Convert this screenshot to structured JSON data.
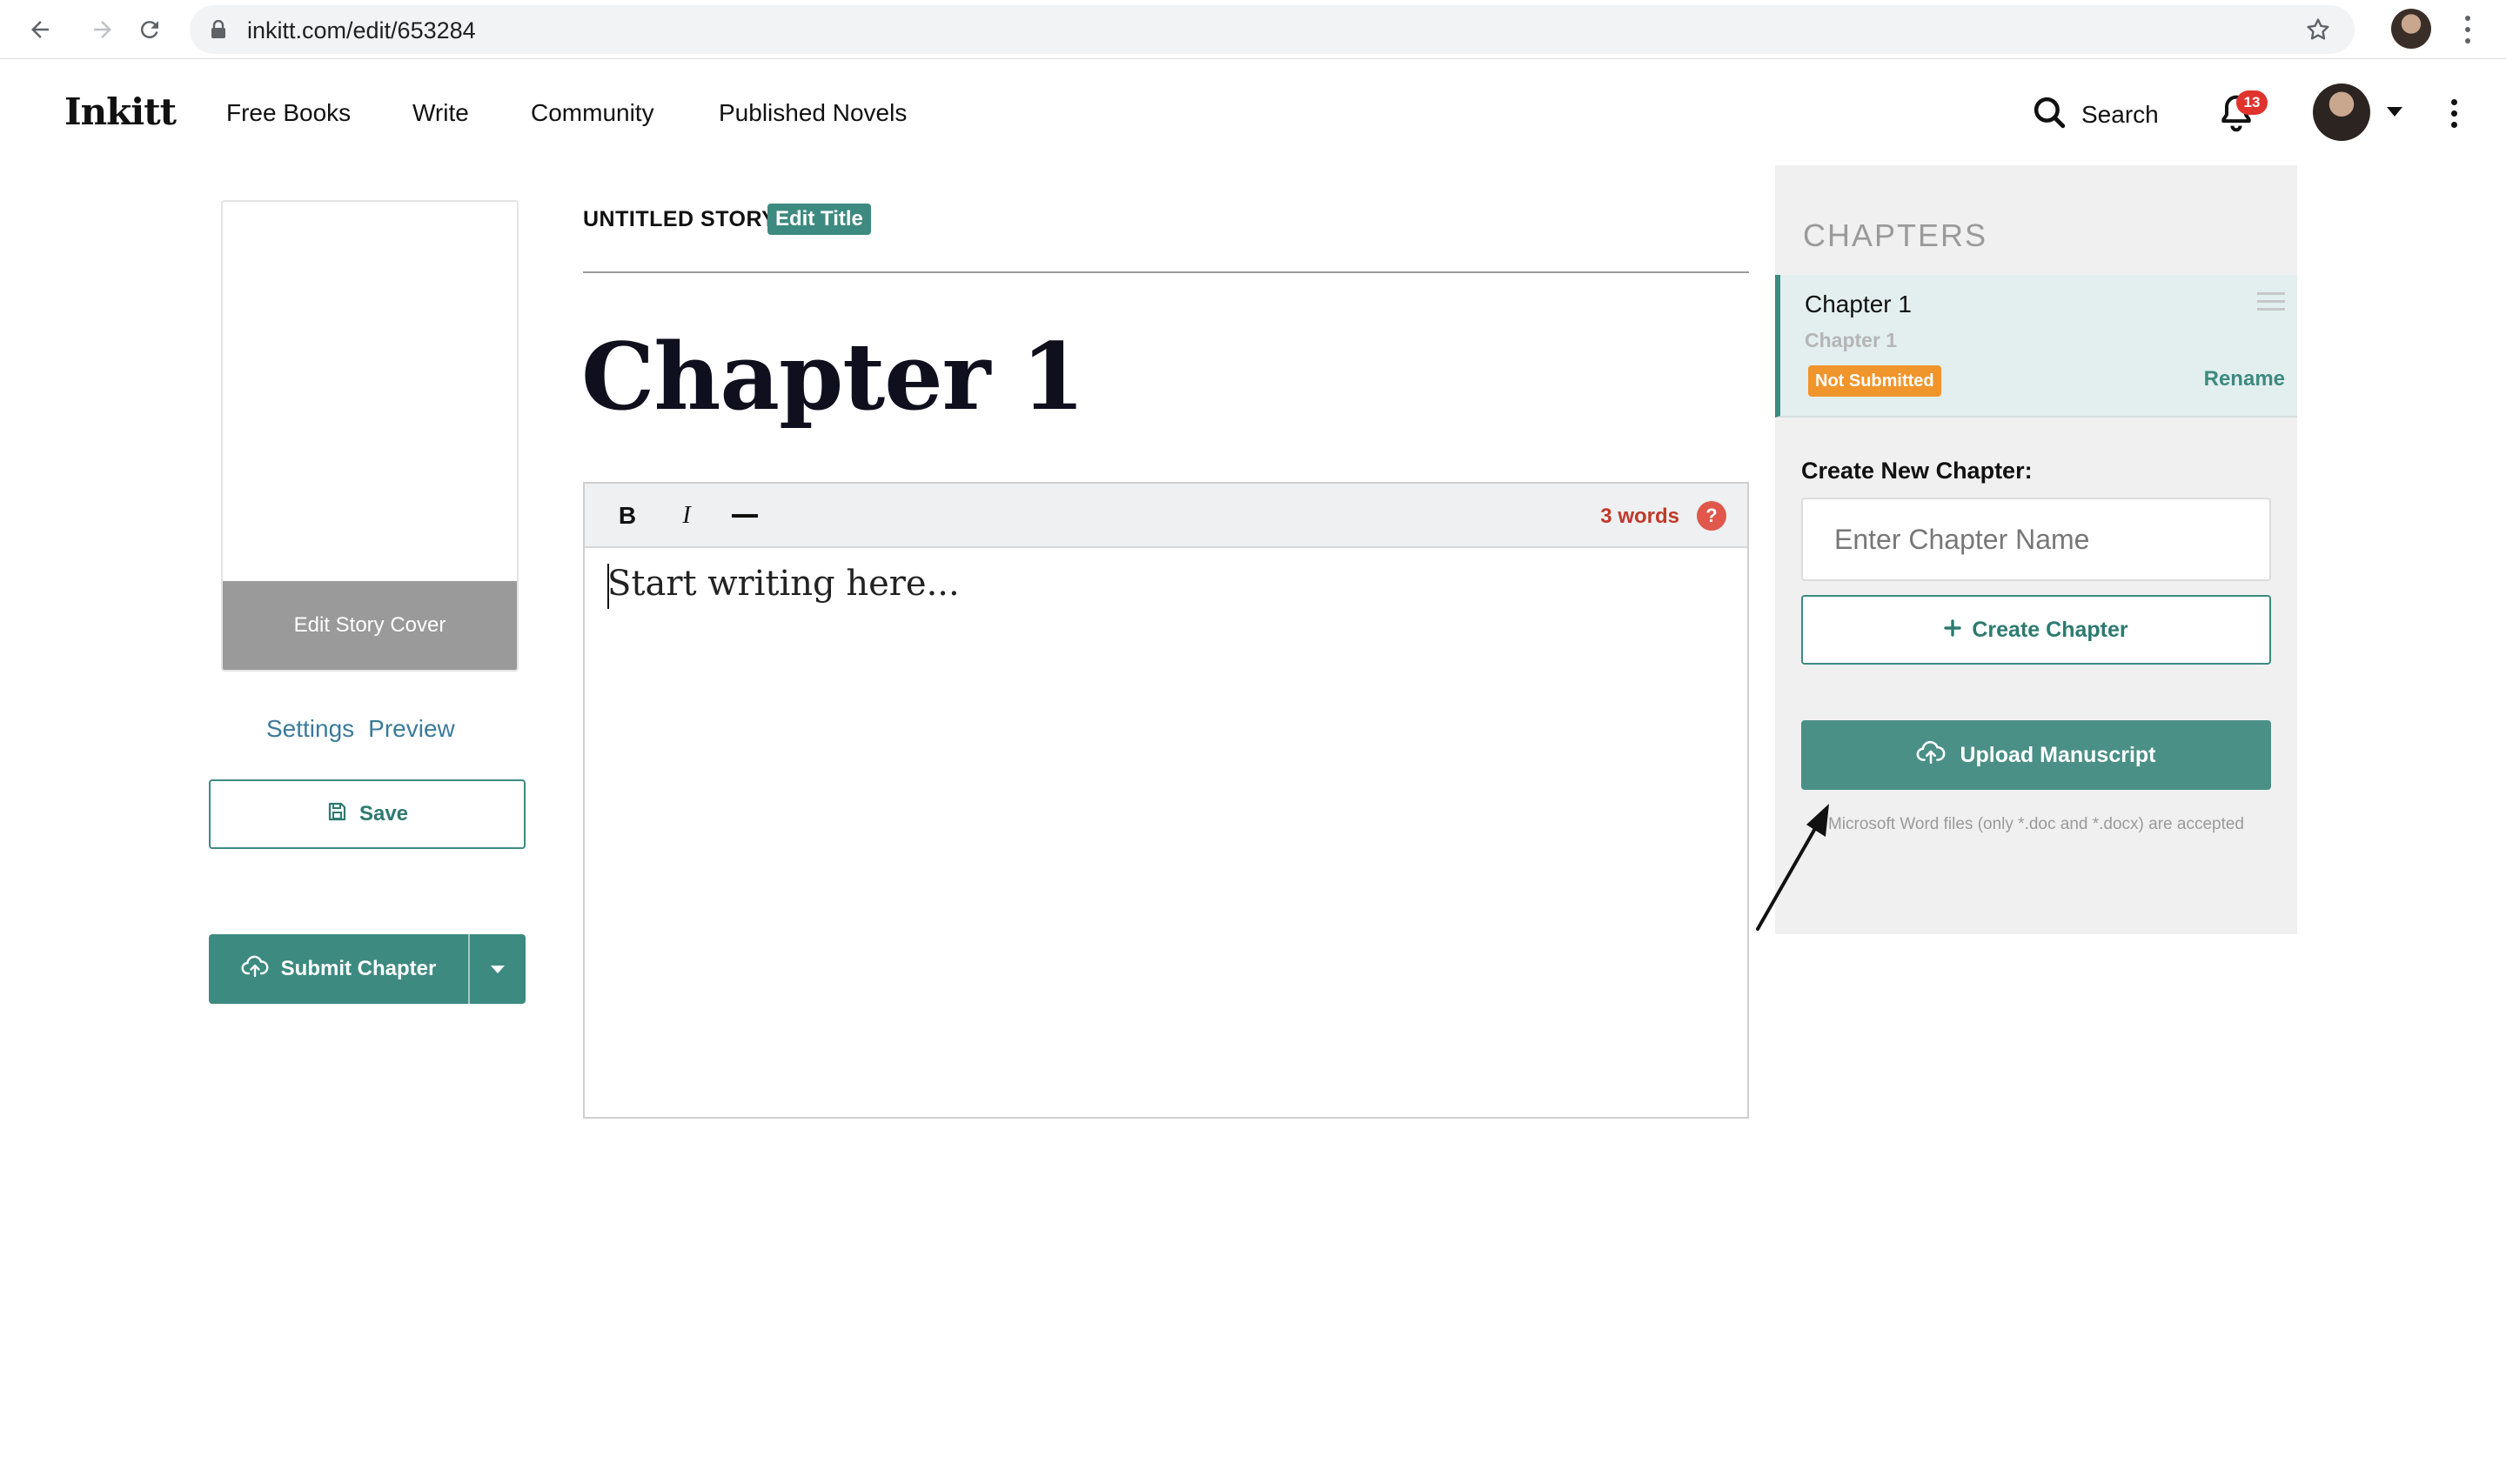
{
  "browser": {
    "url": "inkitt.com/edit/653284",
    "back_icon": "back-arrow-icon",
    "forward_icon": "forward-arrow-icon",
    "reload_icon": "reload-icon"
  },
  "header": {
    "logo": "Inkitt",
    "nav": [
      "Free Books",
      "Write",
      "Community",
      "Published Novels"
    ],
    "search_label": "Search",
    "notification_count": "13"
  },
  "left": {
    "cover_button": "Edit Story Cover",
    "settings_link": "Settings",
    "preview_link": "Preview",
    "save_label": "Save",
    "submit_label": "Submit Chapter"
  },
  "editor": {
    "story_title": "UNTITLED STORY",
    "edit_title_label": "Edit Title",
    "chapter_heading": "Chapter 1",
    "bold_label": "B",
    "italic_label": "I",
    "word_count": "3 words",
    "help_label": "?",
    "placeholder": "Start writing here..."
  },
  "chapters": {
    "panel_title": "CHAPTERS",
    "items": [
      {
        "name": "Chapter 1",
        "subtitle": "Chapter 1",
        "status": "Not Submitted",
        "rename_label": "Rename"
      }
    ],
    "create_label": "Create New Chapter:",
    "name_placeholder": "Enter Chapter Name",
    "create_button": "Create Chapter",
    "upload_button": "Upload Manuscript",
    "upload_note": "Microsoft Word files (only *.doc and *.docx) are accepted"
  },
  "colors": {
    "accent": "#3d8a80",
    "status_orange": "#f0952c",
    "word_count_red": "#c0392b",
    "badge_red": "#e0332e"
  }
}
